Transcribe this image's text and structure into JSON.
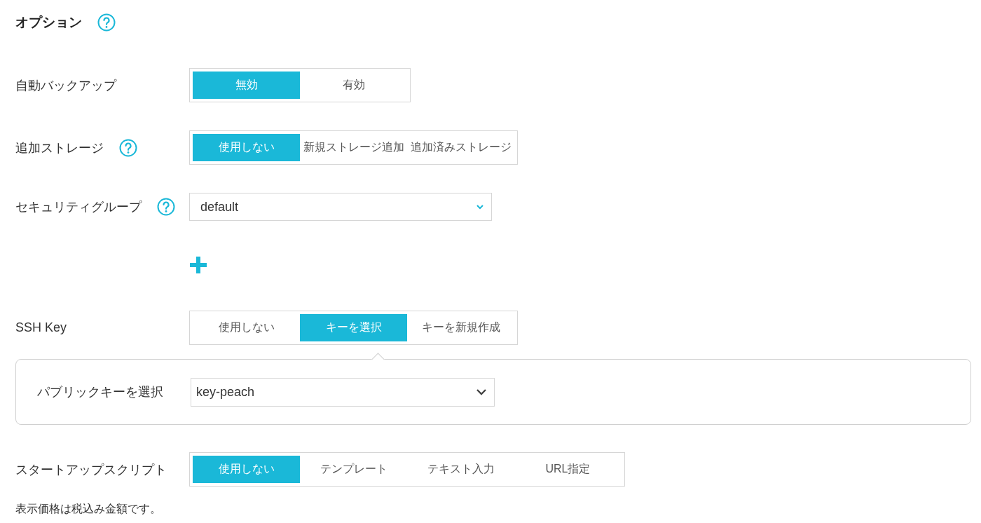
{
  "section": {
    "title": "オプション",
    "help": true
  },
  "rows": [
    {
      "kind": "toggle",
      "label": "自動バックアップ",
      "help": false,
      "options": [
        {
          "label": "無効",
          "selected": true
        },
        {
          "label": "有効",
          "selected": false
        }
      ]
    },
    {
      "kind": "toggle",
      "label": "追加ストレージ",
      "help": true,
      "options": [
        {
          "label": "使用しない",
          "selected": true
        },
        {
          "label": "新規ストレージ追加",
          "selected": false
        },
        {
          "label": "追加済みストレージ",
          "selected": false
        }
      ]
    },
    {
      "kind": "select",
      "label": "セキュリティグループ",
      "help": true,
      "value": "default"
    },
    {
      "kind": "add"
    },
    {
      "kind": "toggle",
      "label": "SSH Key",
      "help": false,
      "options": [
        {
          "label": "使用しない",
          "selected": false
        },
        {
          "label": "キーを選択",
          "selected": true
        },
        {
          "label": "キーを新規作成",
          "selected": false
        }
      ],
      "panel": {
        "label": "パブリックキーを選択",
        "value": "key-peach"
      }
    },
    {
      "kind": "toggle",
      "label": "スタートアップスクリプト",
      "help": false,
      "options": [
        {
          "label": "使用しない",
          "selected": true
        },
        {
          "label": "テンプレート",
          "selected": false
        },
        {
          "label": "テキスト入力",
          "selected": false
        },
        {
          "label": "URL指定",
          "selected": false
        }
      ]
    }
  ],
  "note": "表示価格は税込み金額です。"
}
